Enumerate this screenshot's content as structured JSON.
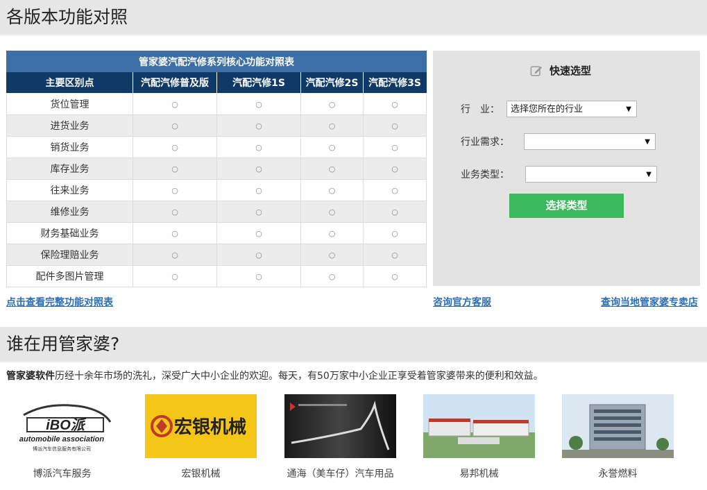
{
  "section1": {
    "title": "各版本功能对照"
  },
  "table": {
    "caption": "管家婆汽配汽修系列核心功能对照表",
    "headers": [
      "主要区别点",
      "汽配汽修普及版",
      "汽配汽修1S",
      "汽配汽修2S",
      "汽配汽修3S"
    ],
    "rows": [
      {
        "feature": "货位管理",
        "marks": [
          "○",
          "○",
          "○",
          "○"
        ]
      },
      {
        "feature": "进货业务",
        "marks": [
          "○",
          "○",
          "○",
          "○"
        ]
      },
      {
        "feature": "销货业务",
        "marks": [
          "○",
          "○",
          "○",
          "○"
        ]
      },
      {
        "feature": "库存业务",
        "marks": [
          "○",
          "○",
          "○",
          "○"
        ]
      },
      {
        "feature": "往来业务",
        "marks": [
          "○",
          "○",
          "○",
          "○"
        ]
      },
      {
        "feature": "维修业务",
        "marks": [
          "○",
          "○",
          "○",
          "○"
        ]
      },
      {
        "feature": "财务基础业务",
        "marks": [
          "○",
          "○",
          "○",
          "○"
        ]
      },
      {
        "feature": "保险理赔业务",
        "marks": [
          "○",
          "○",
          "○",
          "○"
        ]
      },
      {
        "feature": "配件多图片管理",
        "marks": [
          "○",
          "○",
          "○",
          "○"
        ]
      }
    ]
  },
  "quick": {
    "title": "快速选型",
    "icon": "edit-icon",
    "industry_label": "行　业：",
    "industry_value": "选择您所在的行业",
    "need_label": "行业需求：",
    "need_value": "",
    "biz_label": "业务类型：",
    "biz_value": "",
    "button": "选择类型"
  },
  "links": {
    "full_table": "点击查看完整功能对照表",
    "service": "咨询官方客服",
    "store": "查询当地管家婆专卖店"
  },
  "section2": {
    "title": "谁在用管家婆?"
  },
  "intro": {
    "brand": "管家婆软件",
    "text": "历经十余年市场的洗礼，深受广大中小企业的欢迎。每天，有50万家中小企业正享受着管家婆带来的便利和效益。"
  },
  "clients": [
    {
      "name": "博派汽车服务",
      "logo_text": "iBO派",
      "logo_sub": "automobile association",
      "logo_sub2": "博派汽车信息服务有限公司"
    },
    {
      "name": "宏银机械",
      "logo_text": "宏银机械"
    },
    {
      "name": "通海（美车仔）汽车用品"
    },
    {
      "name": "易邦机械"
    },
    {
      "name": "永誉燃料"
    }
  ],
  "colors": {
    "table_caption": "#3b6fa6",
    "table_header": "#0f3a68",
    "button": "#3bb95c",
    "link": "#2d6db5",
    "panel": "#e3e3e3"
  }
}
